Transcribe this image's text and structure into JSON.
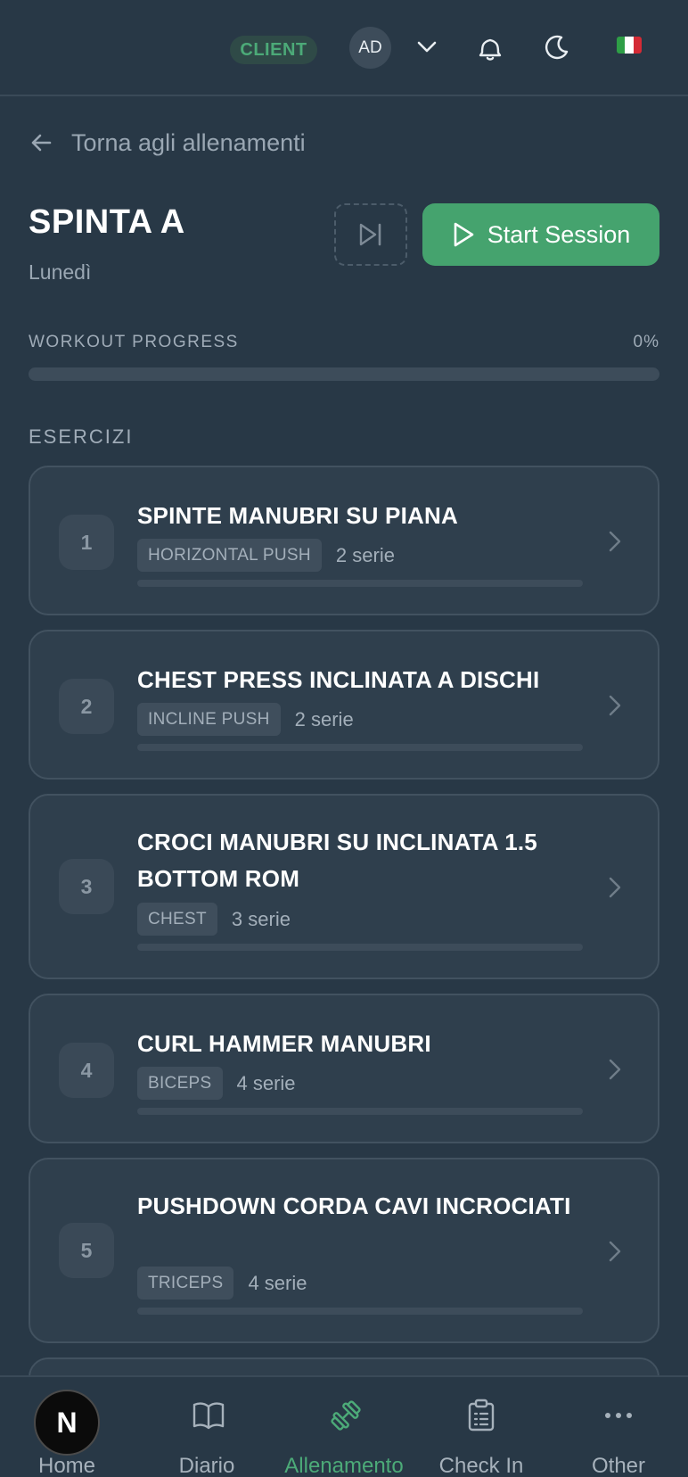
{
  "header": {
    "role_badge": "CLIENT",
    "avatar_initials": "AD",
    "flag_colors": [
      "#2e9e46",
      "#ffffff",
      "#d42a35"
    ]
  },
  "back_link": {
    "label": "Torna agli allenamenti"
  },
  "workout": {
    "title": "SPINTA A",
    "day": "Lunedì",
    "start_label": "Start Session"
  },
  "progress": {
    "label": "WORKOUT PROGRESS",
    "value": "0%",
    "fraction": 0
  },
  "exercises_label": "ESERCIZI",
  "exercises": [
    {
      "num": "1",
      "name": "SPINTE MANUBRI SU PIANA",
      "tag": "HORIZONTAL PUSH",
      "sets": "2 serie"
    },
    {
      "num": "2",
      "name": "CHEST PRESS INCLINATA A DISCHI",
      "tag": "INCLINE PUSH",
      "sets": "2 serie"
    },
    {
      "num": "3",
      "name": "CROCI MANUBRI SU INCLINATA 1.5 BOTTOM ROM",
      "tag": "CHEST",
      "sets": "3 serie"
    },
    {
      "num": "4",
      "name": "CURL HAMMER MANUBRI",
      "tag": "BICEPS",
      "sets": "4 serie"
    },
    {
      "num": "5",
      "name": "PUSHDOWN CORDA CAVI INCROCIATI",
      "tag": "TRICEPS",
      "sets": "4 serie"
    }
  ],
  "nav": {
    "items": [
      {
        "label": "Home",
        "icon": "home-icon"
      },
      {
        "label": "Diario",
        "icon": "book-icon"
      },
      {
        "label": "Allenamento",
        "icon": "dumbbell-icon",
        "active": true
      },
      {
        "label": "Check In",
        "icon": "clipboard-icon"
      },
      {
        "label": "Other",
        "icon": "more-icon"
      }
    ],
    "fab_letter": "N"
  },
  "colors": {
    "background": "#283846",
    "accent": "#45a36e",
    "card": "#2f3f4d"
  }
}
